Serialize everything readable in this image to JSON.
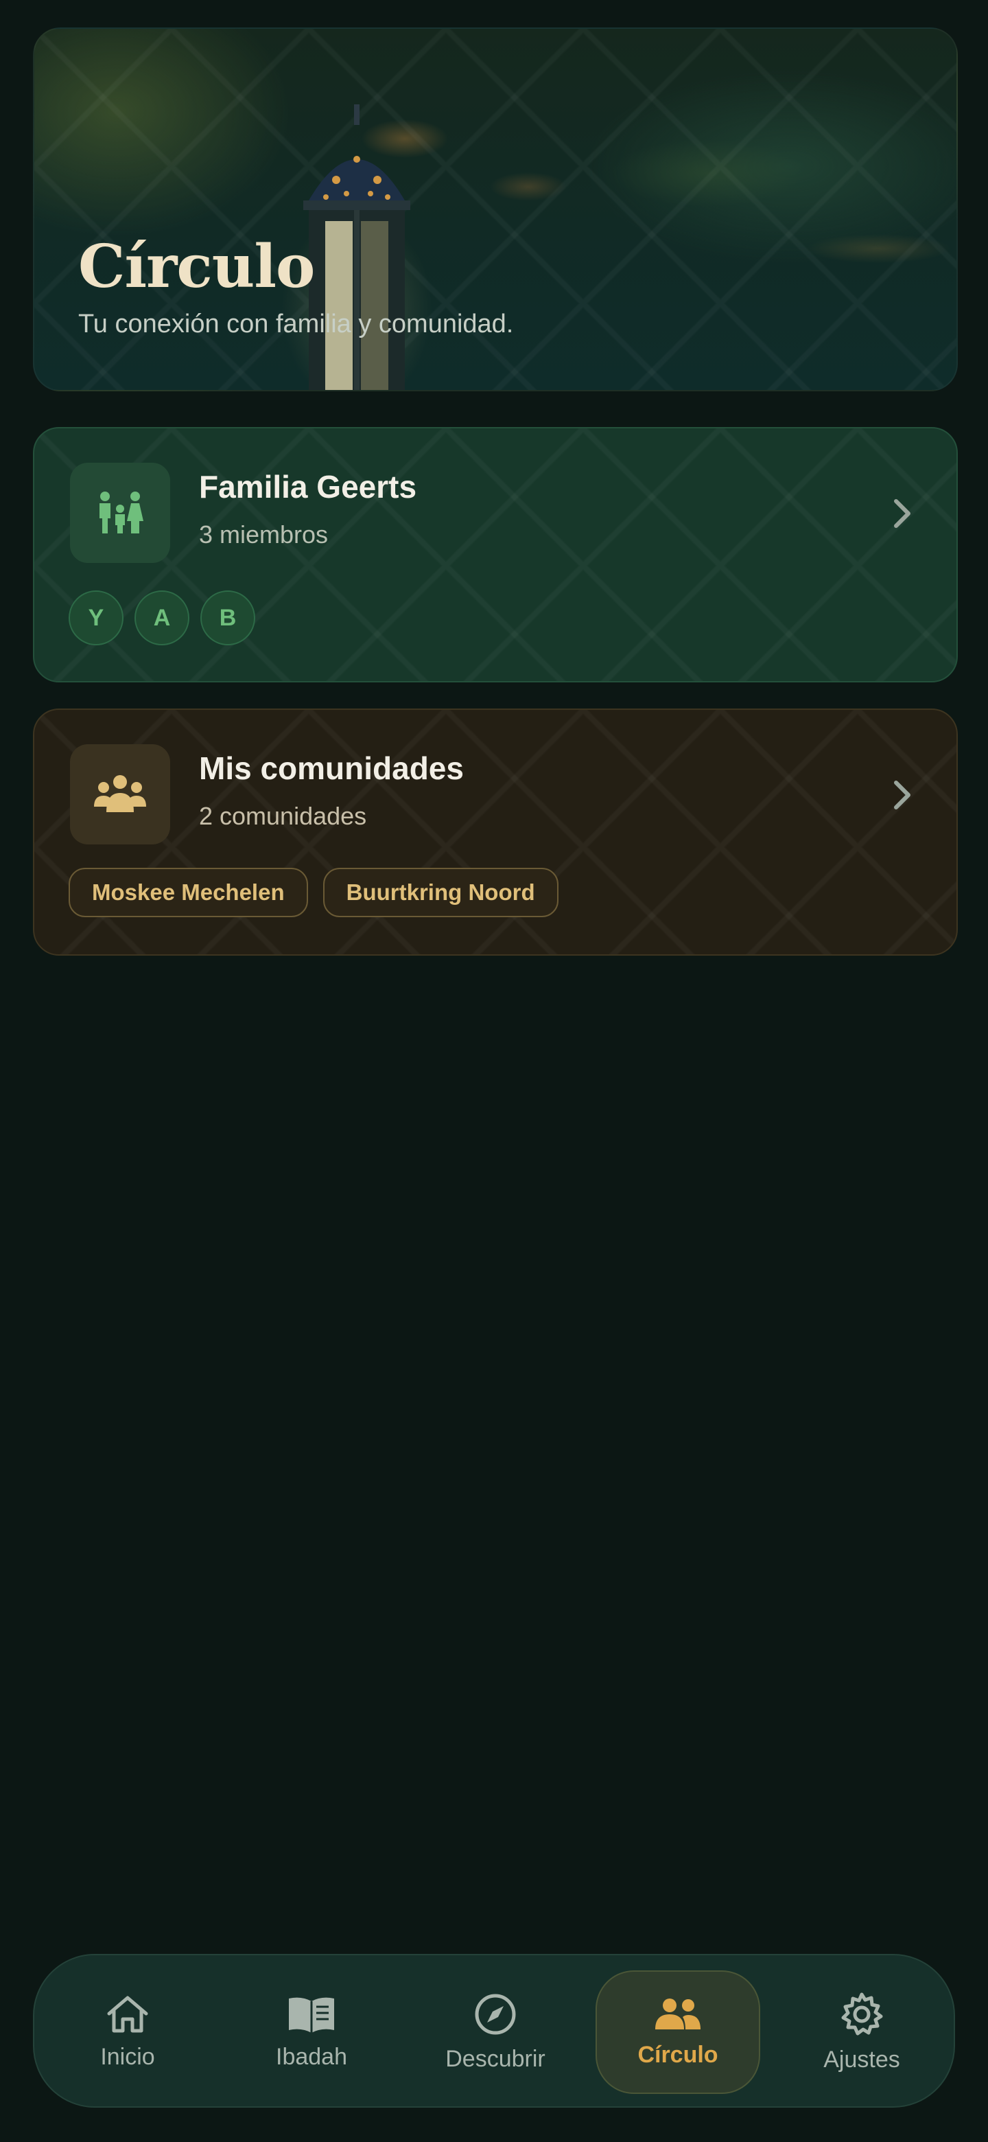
{
  "hero": {
    "title": "Círculo",
    "subtitle": "Tu conexión con familia y comunidad."
  },
  "family_card": {
    "title": "Familia Geerts",
    "subtitle": "3 miembros",
    "icon": "family-icon",
    "members": [
      "Y",
      "A",
      "B"
    ],
    "accent_color": "#6fbf7c"
  },
  "community_card": {
    "title": "Mis comunidades",
    "subtitle": "2 comunidades",
    "icon": "community-icon",
    "communities": [
      "Moskee Mechelen",
      "Buurtkring Noord"
    ],
    "accent_color": "#e0bf7a"
  },
  "nav": {
    "items": [
      {
        "label": "Inicio",
        "icon": "home-icon"
      },
      {
        "label": "Ibadah",
        "icon": "book-icon"
      },
      {
        "label": "Descubrir",
        "icon": "compass-icon"
      },
      {
        "label": "Círculo",
        "icon": "people-icon",
        "active": true
      },
      {
        "label": "Ajustes",
        "icon": "gear-icon"
      }
    ],
    "active_color": "#e0a84a"
  }
}
